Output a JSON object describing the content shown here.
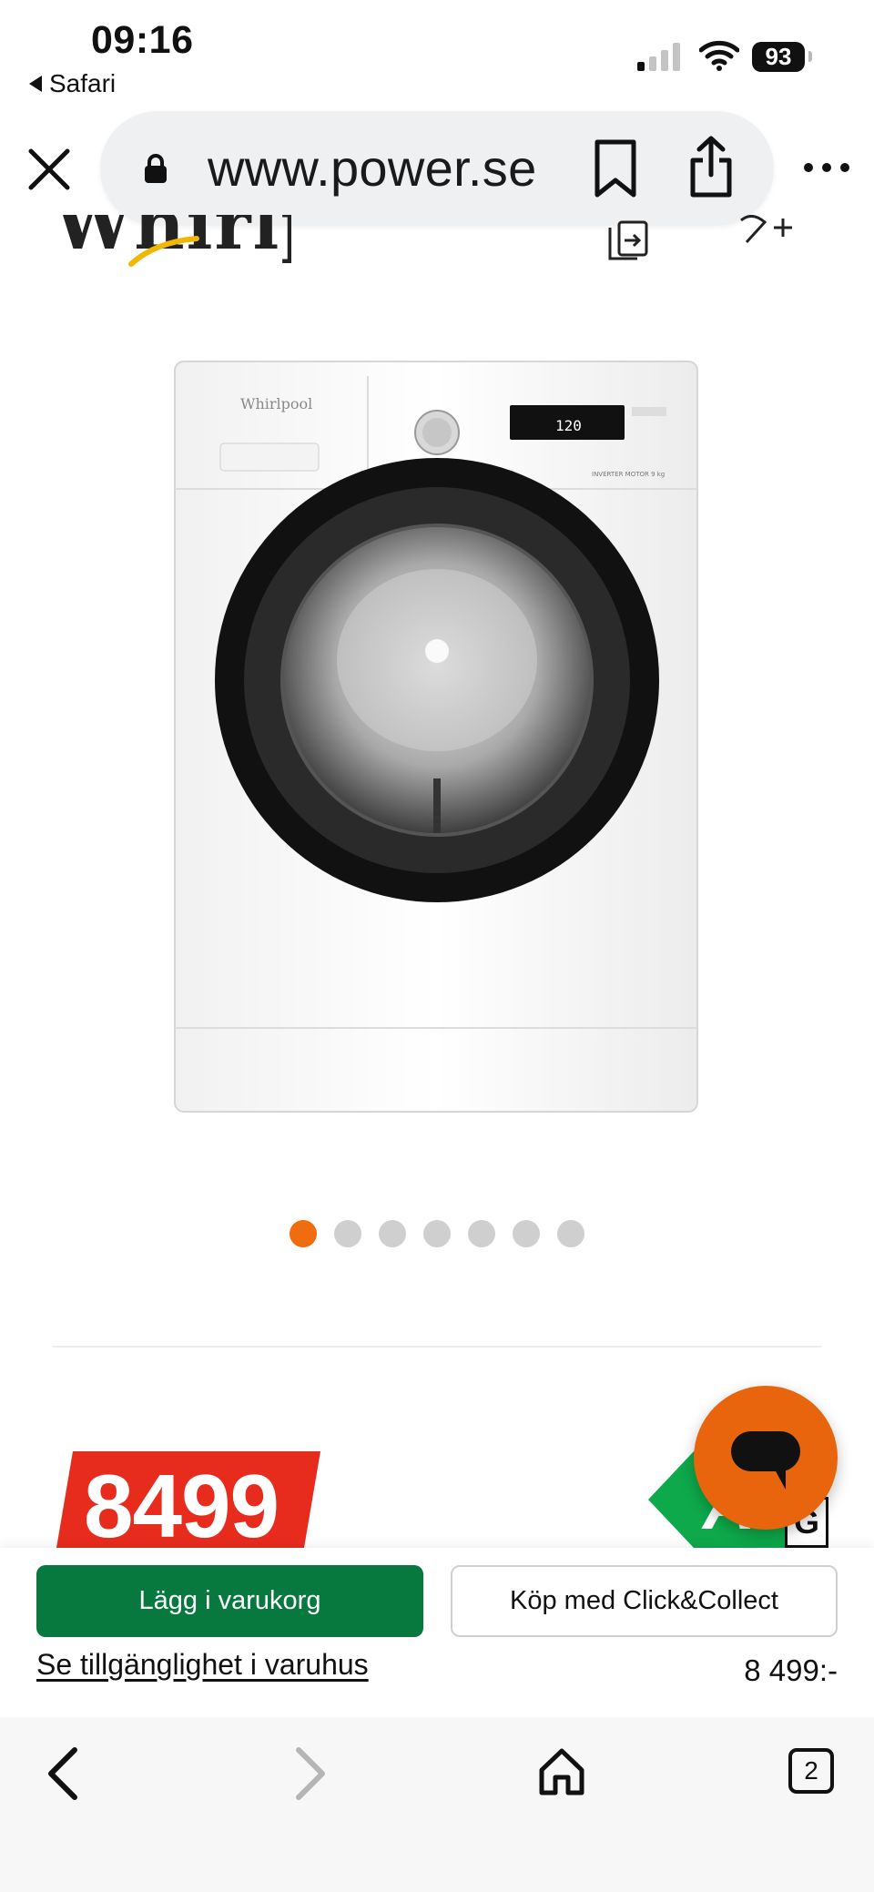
{
  "status_bar": {
    "time": "09:16",
    "back_app": "Safari",
    "battery": "93",
    "signal_icon": "cellular-signal-icon",
    "wifi_icon": "wifi-icon"
  },
  "browser": {
    "url": "www.power.se",
    "close_icon": "close-icon",
    "lock_icon": "lock-icon",
    "bookmark_icon": "bookmark-icon",
    "share_icon": "share-icon",
    "more_icon": "more-icon"
  },
  "page": {
    "brand": "Whirlpool",
    "carousel": {
      "count": 7,
      "active_index": 0,
      "active_color": "#ef6c0f",
      "inactive_color": "#cfcfcf"
    },
    "price": "8499",
    "energy_class": "A",
    "energy_scale_letter": "G",
    "chat_icon": "chat-bubble-icon",
    "chat_color": "#e8650d"
  },
  "buy_bar": {
    "add_to_cart": "Lägg i varukorg",
    "click_collect": "Köp med Click&Collect",
    "stock_link": "Se tillgänglighet i varuhus",
    "price": "8 499:-",
    "primary_color": "#07793f"
  },
  "toolbar": {
    "tabs_count": "2",
    "back_icon": "chevron-left-icon",
    "forward_icon": "chevron-right-icon",
    "home_icon": "home-icon",
    "tabs_icon": "tabs-icon"
  }
}
